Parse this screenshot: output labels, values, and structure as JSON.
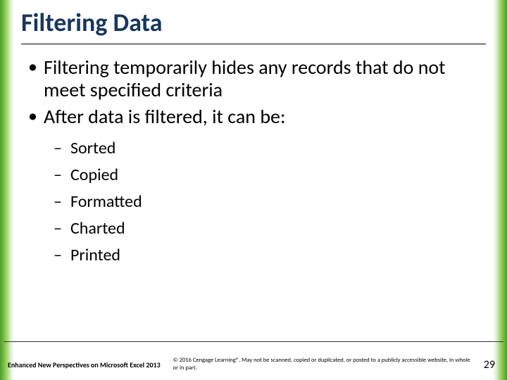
{
  "title": "Filtering Data",
  "bullets": {
    "b0": "Filtering temporarily hides any records that do not meet specified criteria",
    "b1": "After data is filtered, it can be:"
  },
  "subbullets": {
    "s0": "Sorted",
    "s1": "Copied",
    "s2": "Formatted",
    "s3": "Charted",
    "s4": "Printed"
  },
  "footer": {
    "left": "Enhanced New Perspectives on Microsoft Excel 2013",
    "mid": "© 2016 Cengage Learning®. May not be scanned, copied or duplicated, or posted to a publicly accessible website, in whole or in part.",
    "page": "29"
  }
}
